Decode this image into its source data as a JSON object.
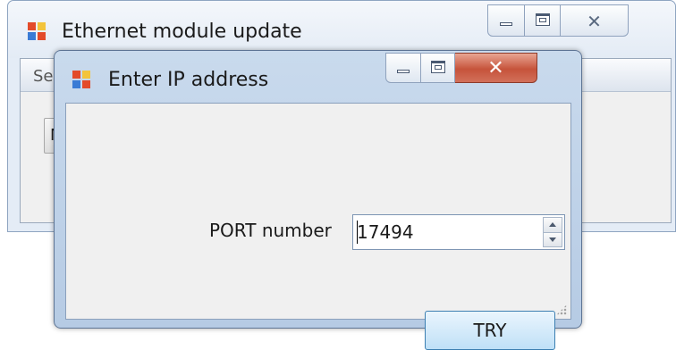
{
  "background_window": {
    "title": "Ethernet module update",
    "menu_text": "Se",
    "button_text": "M"
  },
  "dialog": {
    "title": "Enter IP address",
    "port_label": "PORT number",
    "port_value": "17494",
    "try_label": "TRY"
  },
  "icons": {
    "app": "app-icon",
    "minimize": "minimize-icon",
    "maximize": "maximize-icon",
    "close": "close-icon",
    "spin_up": "spin-up-icon",
    "spin_down": "spin-down-icon",
    "resize_grip": "resize-grip-icon"
  },
  "colors": {
    "title_glass": "#c9daed",
    "close_red": "#c6533b",
    "button_blue": "#bfe0f7"
  }
}
